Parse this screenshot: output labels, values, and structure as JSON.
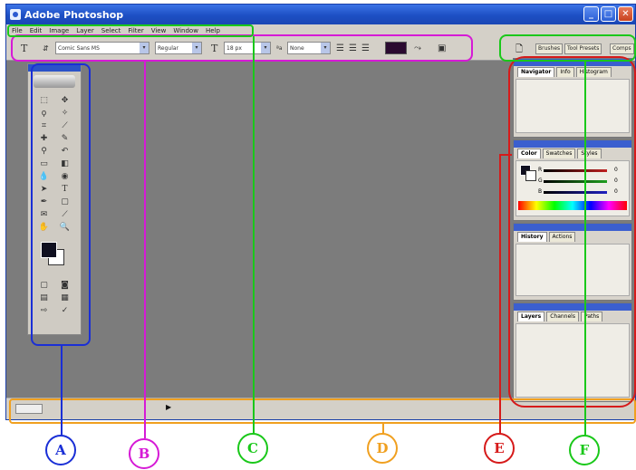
{
  "window": {
    "title": "Adobe Photoshop"
  },
  "menu": [
    "File",
    "Edit",
    "Image",
    "Layer",
    "Select",
    "Filter",
    "View",
    "Window",
    "Help"
  ],
  "options_bar": {
    "font_family": "Comic Sans MS",
    "font_style": "Regular",
    "font_size": "18 px",
    "anti_alias": "None"
  },
  "palette_well": {
    "tabs": [
      "Brushes",
      "Tool Presets",
      "Comps"
    ]
  },
  "palettes": {
    "navigator_tabs": [
      "Navigator",
      "Info",
      "Histogram"
    ],
    "color_tabs": [
      "Color",
      "Swatches",
      "Styles"
    ],
    "color_channels": [
      {
        "label": "R",
        "value": "0",
        "color": "#c02020"
      },
      {
        "label": "G",
        "value": "0",
        "color": "#20a020"
      },
      {
        "label": "B",
        "value": "0",
        "color": "#2020c0"
      }
    ],
    "history_tabs": [
      "History",
      "Actions"
    ],
    "layers_tabs": [
      "Layers",
      "Channels",
      "Paths"
    ]
  },
  "callouts": [
    {
      "letter": "A",
      "color": "#1a2fd6"
    },
    {
      "letter": "B",
      "color": "#d61ad6"
    },
    {
      "letter": "C",
      "color": "#1ac81a"
    },
    {
      "letter": "D",
      "color": "#f0a020"
    },
    {
      "letter": "E",
      "color": "#d61a1a"
    },
    {
      "letter": "F",
      "color": "#1ac81a"
    }
  ]
}
